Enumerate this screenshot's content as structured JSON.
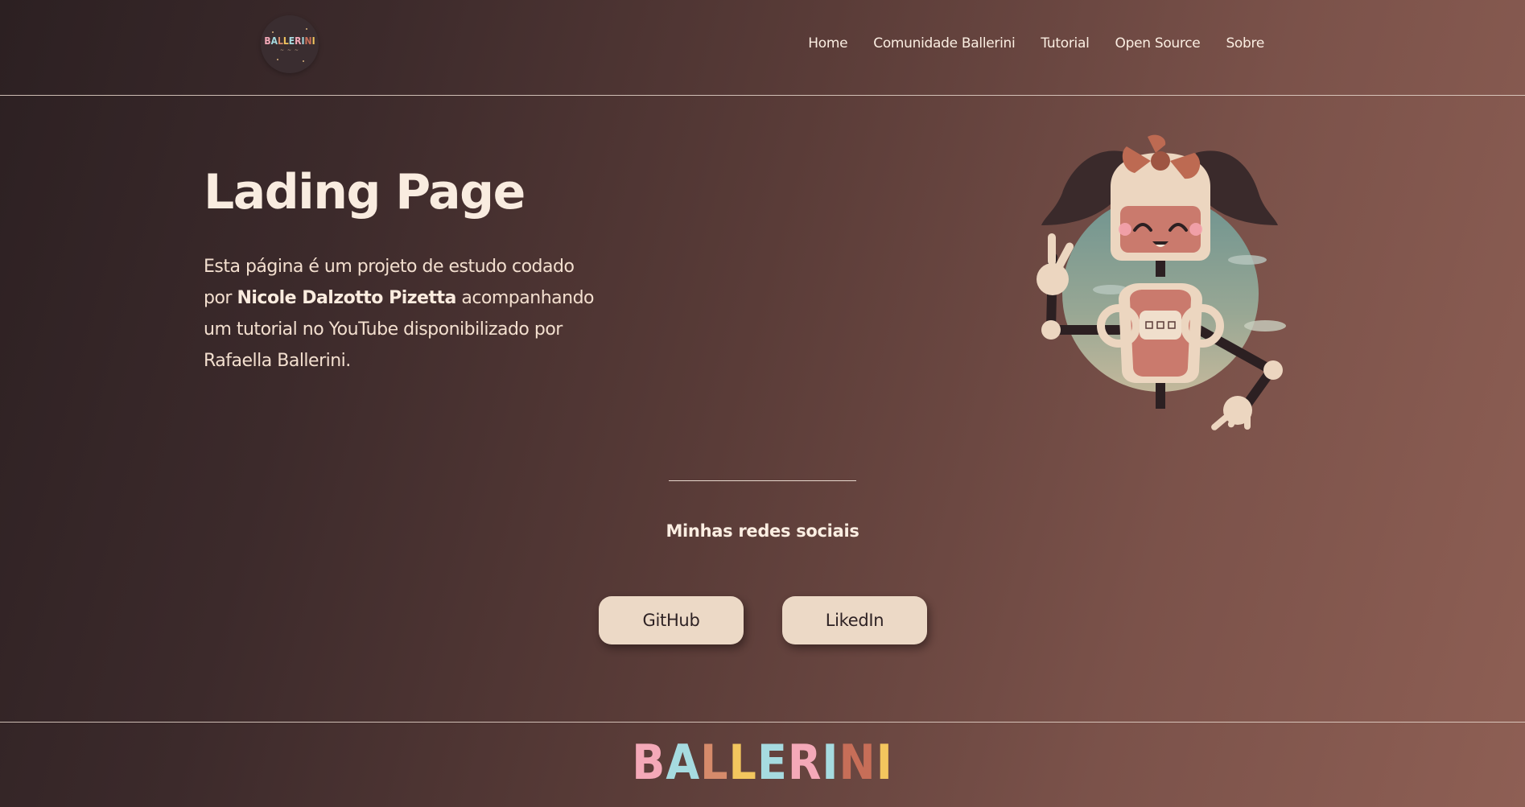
{
  "header": {
    "logo_text": "BALLERINI",
    "logo_sub": "~ ~ ~",
    "nav": [
      "Home",
      "Comunidade Ballerini",
      "Tutorial",
      "Open Source",
      "Sobre"
    ]
  },
  "hero": {
    "title": "Lading Page",
    "text_1": "Esta página é um projeto de estudo codado por ",
    "author": "Nicole Dalzotto Pizetta",
    "text_2": " acompanhando um tutorial no YouTube disponibilizado por Rafaella Ballerini.",
    "illustration_icon": "robot-girl-illustration"
  },
  "social": {
    "title": "Minhas redes sociais",
    "github_label": "GitHub",
    "linkedin_label": "LikedIn"
  },
  "footer": {
    "logo_letters": [
      "B",
      "A",
      "L",
      "L",
      "E",
      "R",
      "I",
      "N",
      "I"
    ],
    "logo_colors": [
      "#f4a9b8",
      "#a6dbe0",
      "#d68b6b",
      "#f3c65e",
      "#a6dbe0",
      "#f4a9b8",
      "#a6dbe0",
      "#c76e58",
      "#f3c65e"
    ]
  },
  "colors": {
    "background_start": "#2c2022",
    "background_end": "#8e5f54",
    "button_bg": "#ecd9c6",
    "text_light": "#f9ece0"
  }
}
